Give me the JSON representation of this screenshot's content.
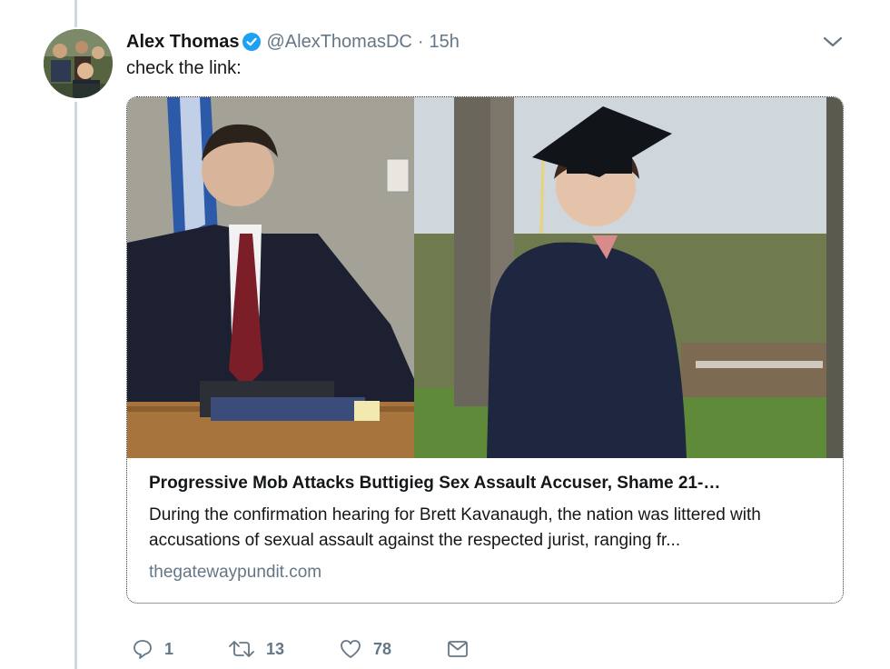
{
  "tweet": {
    "display_name": "Alex Thomas",
    "verified": true,
    "handle": "@AlexThomasDC",
    "separator": "·",
    "time": "15h",
    "text": "check the link:"
  },
  "card": {
    "title": "Progressive Mob Attacks Buttigieg Sex Assault Accuser, Shame 21-…",
    "description": "During the confirmation hearing for Brett Kavanaugh, the nation was littered with accusations of sexual assault against the respected jurist, ranging fr...",
    "domain": "thegatewaypundit.com"
  },
  "actions": {
    "reply_count": "1",
    "retweet_count": "13",
    "like_count": "78"
  },
  "colors": {
    "accent": "#1da1f2",
    "secondary_text": "#657786",
    "thread_line": "#cfd8de"
  },
  "icons": [
    "verified-badge-icon",
    "chevron-down-icon",
    "reply-icon",
    "retweet-icon",
    "like-icon",
    "direct-message-icon"
  ]
}
